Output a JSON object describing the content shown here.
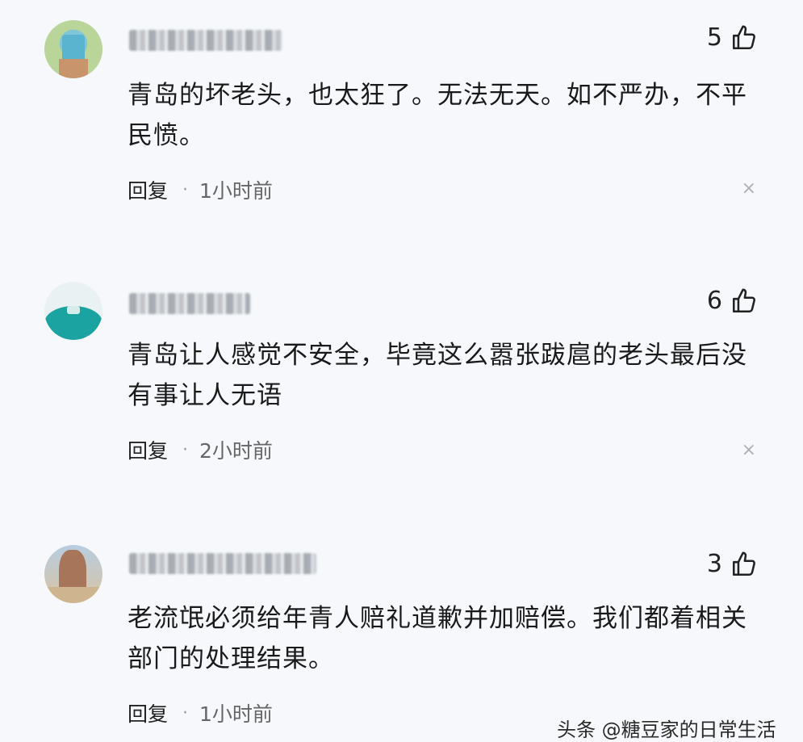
{
  "comments": [
    {
      "likes": "5",
      "text": "青岛的坏老头，也太狂了。无法无天。如不严办，不平民愤。",
      "reply_label": "回复",
      "time": "1小时前",
      "close_glyph": "×",
      "avatar_colors": [
        "#b9d59a",
        "#5ab4cf",
        "#c8946b"
      ]
    },
    {
      "likes": "6",
      "text": "青岛让人感觉不安全，毕竟这么嚣张跋扈的老头最后没有事让人无语",
      "reply_label": "回复",
      "time": "2小时前",
      "close_glyph": "×",
      "avatar_colors": [
        "#e9f1f3",
        "#1aa3a0"
      ]
    },
    {
      "likes": "3",
      "text": "老流氓必须给年青人赔礼道歉并加赔偿。我们都着相关部门的处理结果。",
      "reply_label": "回复",
      "time": "1小时前",
      "close_glyph": "×",
      "avatar_colors": [
        "#b8cde0",
        "#a7765a",
        "#cfb58f"
      ]
    }
  ],
  "separator": "·",
  "icons": {
    "like": "thumbs-up-icon",
    "close": "close-icon"
  },
  "watermark": "头条 @糖豆家的日常生活"
}
